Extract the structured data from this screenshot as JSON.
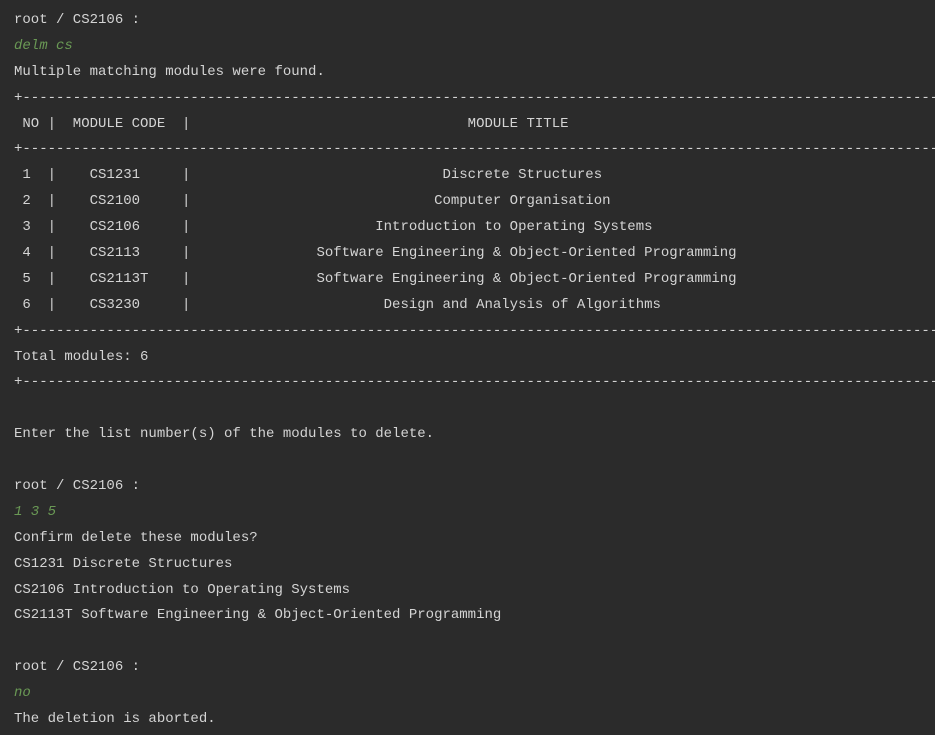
{
  "prompts": {
    "prompt1": "root / CS2106 :",
    "prompt2": "root / CS2106 :",
    "prompt3": "root / CS2106 :"
  },
  "inputs": {
    "cmd1": "delm cs",
    "cmd2": "1 3 5",
    "cmd3": "no"
  },
  "messages": {
    "multipleFound": "Multiple matching modules were found.",
    "totalModules": "Total modules: 6",
    "enterNumbers": "Enter the list number(s) of the modules to delete.",
    "confirmDelete": "Confirm delete these modules?",
    "aborted": "The deletion is aborted."
  },
  "confirmList": {
    "item1": "CS1231 Discrete Structures",
    "item2": "CS2106 Introduction to Operating Systems",
    "item3": "CS2113T Software Engineering & Object-Oriented Programming"
  },
  "table": {
    "borderTop": "+--------------------------------------------------------------------------------------------------------------+",
    "header": " NO |  MODULE CODE  |                                 MODULE TITLE                                              ",
    "borderMid": "+--------------------------------------------------------------------------------------------------------------+",
    "row1": " 1  |    CS1231     |                              Discrete Structures                                          ",
    "row2": " 2  |    CS2100     |                             Computer Organisation                                         ",
    "row3": " 3  |    CS2106     |                      Introduction to Operating Systems                                    ",
    "row4": " 4  |    CS2113     |               Software Engineering & Object-Oriented Programming                          ",
    "row5": " 5  |    CS2113T    |               Software Engineering & Object-Oriented Programming                          ",
    "row6": " 6  |    CS3230     |                       Design and Analysis of Algorithms                                   ",
    "borderBot": "+--------------------------------------------------------------------------------------------------------------+",
    "borderFinal": "+--------------------------------------------------------------------------------------------------------------+"
  }
}
